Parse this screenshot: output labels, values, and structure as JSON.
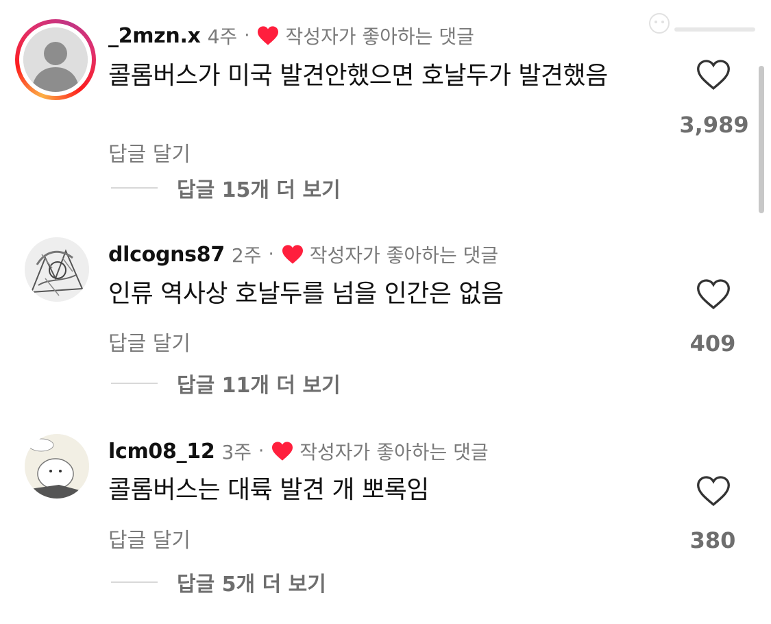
{
  "comments": [
    {
      "username": "_2mzn.x",
      "time": "4주",
      "separator": "·",
      "liked_by_author_label": "작성자가 좋아하는 댓글",
      "text": "콜롬버스가 미국 발견안했으면 호날두가 발견했음",
      "reply_label": "답글 달기",
      "view_replies_label": "답글 15개 더 보기",
      "like_count": "3,989",
      "avatar_has_story_ring": true
    },
    {
      "username": "dlcogns87",
      "time": "2주",
      "separator": "·",
      "liked_by_author_label": "작성자가 좋아하는 댓글",
      "text": "인류 역사상 호날두를 넘을 인간은 없음",
      "reply_label": "답글 달기",
      "view_replies_label": "답글 11개 더 보기",
      "like_count": "409",
      "avatar_has_story_ring": false
    },
    {
      "username": "lcm08_12",
      "time": "3주",
      "separator": "·",
      "liked_by_author_label": "작성자가 좋아하는 댓글",
      "text": "콜롬버스는 대륙 발견 개 뽀록임",
      "reply_label": "답글 달기",
      "view_replies_label": "답글 5개 더 보기",
      "like_count": "380",
      "avatar_has_story_ring": false
    }
  ],
  "icons": {
    "like": "heart-outline-icon",
    "author_liked": "heart-filled-icon",
    "default_avatar": "person-silhouette-icon"
  },
  "colors": {
    "author_heart": "#ff1f3d",
    "secondary_text": "#7a7a7a",
    "story_ring_start": "#fcb045",
    "story_ring_end": "#c13584"
  }
}
